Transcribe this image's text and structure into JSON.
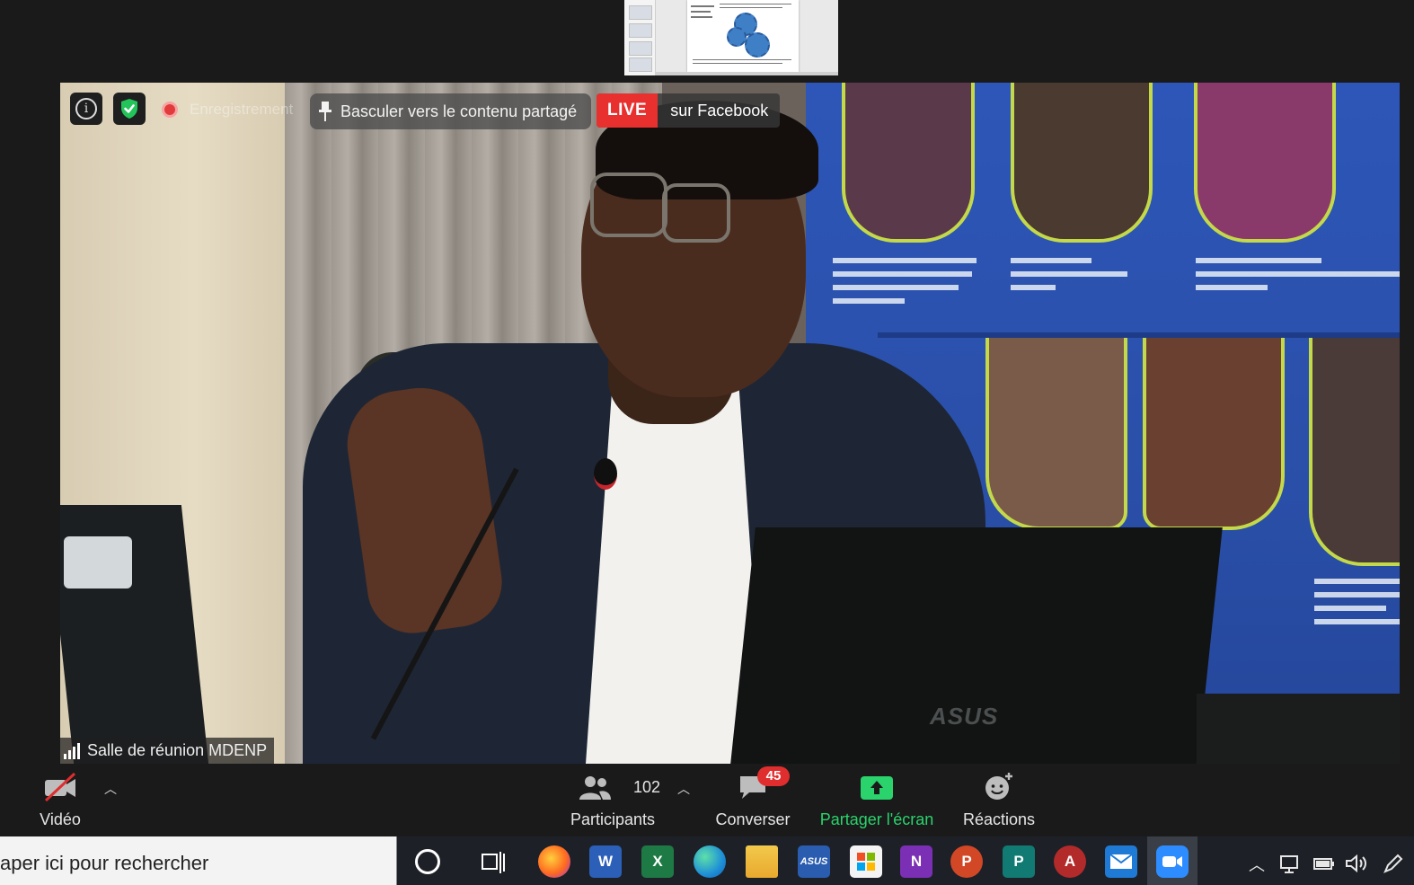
{
  "overlay": {
    "recording_label": "Enregistrement",
    "pin_button_label": "Basculer vers le contenu partagé",
    "live_badge": "LIVE",
    "live_destination": "sur Facebook",
    "participant_name": "Salle de réunion MDENP"
  },
  "background_brand": "ASUS",
  "controls": {
    "video_label": "Vidéo",
    "participants_label": "Participants",
    "participants_count": "102",
    "chat_label": "Converser",
    "chat_badge": "45",
    "share_label": "Partager l'écran",
    "reactions_label": "Réactions"
  },
  "taskbar": {
    "search_placeholder": "aper ici pour rechercher",
    "apps": [
      {
        "name": "firefox",
        "glyph": ""
      },
      {
        "name": "word",
        "glyph": "W"
      },
      {
        "name": "excel",
        "glyph": "X"
      },
      {
        "name": "edge",
        "glyph": ""
      },
      {
        "name": "file-explorer",
        "glyph": ""
      },
      {
        "name": "asus",
        "glyph": "ASUS"
      },
      {
        "name": "store",
        "glyph": ""
      },
      {
        "name": "onenote",
        "glyph": "N"
      },
      {
        "name": "powerpoint",
        "glyph": "P"
      },
      {
        "name": "publisher",
        "glyph": "P"
      },
      {
        "name": "access",
        "glyph": "A"
      },
      {
        "name": "mail",
        "glyph": ""
      },
      {
        "name": "zoom",
        "glyph": ""
      }
    ]
  },
  "colors": {
    "live": "#e8312f",
    "share_green": "#2ad36c",
    "badge_red": "#e02d2d",
    "shield_green": "#23c45a"
  }
}
